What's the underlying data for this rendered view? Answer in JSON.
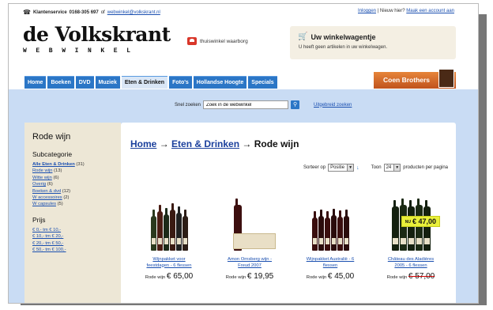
{
  "topbar": {
    "service_label": "Klantenservice",
    "phone": "0168-305 697",
    "of": "of",
    "email": "webwinkel@volkskrant.nl"
  },
  "toplinks": {
    "login": "Inloggen",
    "separator": "|",
    "new_here": "Nieuw hier?",
    "create_account": "Maak een account aan"
  },
  "logo": {
    "main": "de Volkskrant",
    "sub": "WEBWINKEL"
  },
  "guarantee": {
    "label": "thuiswinkel waarborg"
  },
  "cart": {
    "title": "Uw winkelwagentje",
    "message": "U heeft geen artikelen in uw winkelwagen."
  },
  "nav": {
    "tabs": [
      {
        "label": "Home",
        "active": false
      },
      {
        "label": "Boeken",
        "active": false
      },
      {
        "label": "DVD",
        "active": false
      },
      {
        "label": "Muziek",
        "active": false
      },
      {
        "label": "Eten & Drinken",
        "active": true
      },
      {
        "label": "Foto's",
        "active": false
      },
      {
        "label": "Hollandse Hoogte",
        "active": false
      },
      {
        "label": "Specials",
        "active": false
      }
    ],
    "promo": "Coen Brothers"
  },
  "search": {
    "label": "Snel zoeken",
    "placeholder": "Zoek in de webwinkel",
    "value": "Zoek in de webwinkel",
    "advanced": "Uitgebreid zoeken"
  },
  "sidebar": {
    "title": "Rode wijn",
    "subcat_heading": "Subcategorie",
    "subcategories": [
      {
        "label": "Alle Eten & Drinken",
        "count": "(31)"
      },
      {
        "label": "Rode wijn",
        "count": "(13)"
      },
      {
        "label": "Witte wijn",
        "count": "(6)"
      },
      {
        "label": "Overig",
        "count": "(6)"
      },
      {
        "label": "Boeken & dvd",
        "count": "(12)"
      },
      {
        "label": "W accessoires",
        "count": "(2)"
      },
      {
        "label": "W capsules",
        "count": "(5)"
      }
    ],
    "price_heading": "Prijs",
    "prices": [
      {
        "label": "€ 0,- tm € 10,-"
      },
      {
        "label": "€ 10,- tm € 20,-"
      },
      {
        "label": "€ 20,- tm € 50,-"
      },
      {
        "label": "€ 50,- tm € 100,-"
      }
    ]
  },
  "main": {
    "crumb_home": "Home",
    "crumb_arrow1": "→",
    "crumb_cat": "Eten & Drinken",
    "crumb_arrow2": "→",
    "crumb_current": "Rode wijn",
    "sort_label": "Sorteer op",
    "sort_value": "Positie",
    "sort_arrow": "↓",
    "show_label": "Toon",
    "show_value": "24",
    "per_page": "producten per pagina"
  },
  "products": [
    {
      "name_line1": "Wijnpakket voor",
      "name_line2": "feestdagen - 6 flessen",
      "price_label": "Rode wijn",
      "price": "€ 65,00",
      "old": false,
      "sale": ""
    },
    {
      "name_line1": "Amon Ornsberg wijn -",
      "name_line2": "Freud 2007",
      "price_label": "Rode wijn",
      "price": "€ 19,95",
      "old": false,
      "sale": ""
    },
    {
      "name_line1": "Wijnpakket Australië - 6",
      "name_line2": "flessen",
      "price_label": "Rode wijn",
      "price": "€ 45,00",
      "old": false,
      "sale": ""
    },
    {
      "name_line1": "Château des Aladières",
      "name_line2": "2005 - 6 flessen",
      "price_label": "Rode wijn",
      "price": "€ 57,00",
      "old": true,
      "sale": "€ 47,00",
      "sale_prefix": "NU"
    }
  ],
  "colors": {
    "nav_blue": "#2b76c6",
    "band_blue": "#c9dcf4",
    "sidebar_beige": "#ede7d6",
    "promo_orange": "#d9692a",
    "sale_yellow": "#e9f03a"
  }
}
